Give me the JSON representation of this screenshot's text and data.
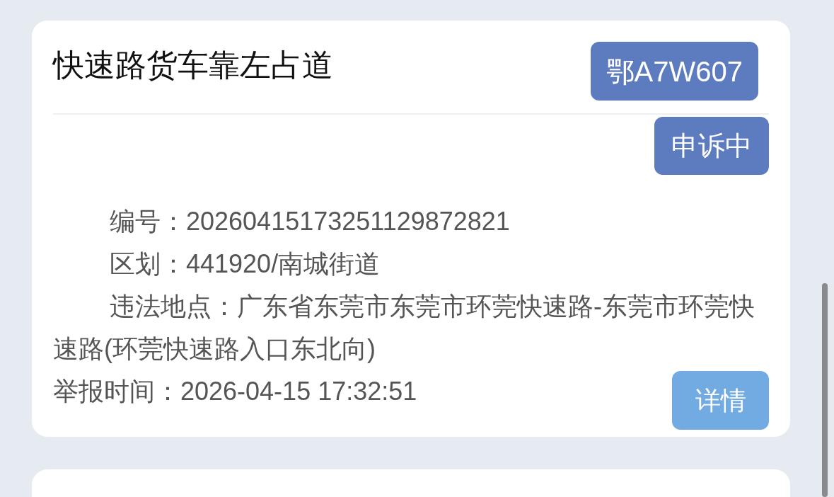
{
  "card": {
    "title": "快速路货车靠左占道",
    "plate": "鄂A7W607",
    "status": "申诉中",
    "lines": [
      "编号：20260415173251129872821",
      "区划：441920/南城街道",
      "违法地点：广东省东莞市东莞市环莞快速路-东莞市环莞快速路(环莞快速路入口东北向)",
      "举报时间：2026-04-15 17:32:51"
    ],
    "detail_button": "详情"
  }
}
